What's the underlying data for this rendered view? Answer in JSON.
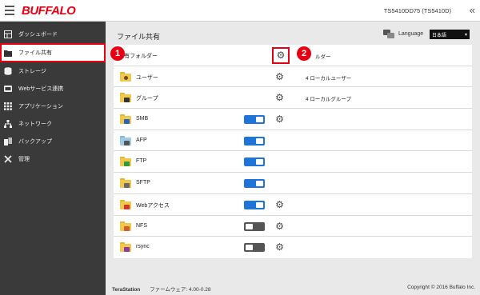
{
  "topbar": {
    "logo": "BUFFALO",
    "device": "TS5410DD75 (TS5410D)",
    "collapse_icon": "double-chevron-left-icon"
  },
  "sidebar": {
    "items": [
      {
        "label": "ダッシュボード",
        "icon": "dashboard-icon"
      },
      {
        "label": "ファイル共有",
        "icon": "folder-icon",
        "active": true
      },
      {
        "label": "ストレージ",
        "icon": "storage-icon"
      },
      {
        "label": "Webサービス連携",
        "icon": "web-service-icon"
      },
      {
        "label": "アプリケーション",
        "icon": "apps-grid-icon"
      },
      {
        "label": "ネットワーク",
        "icon": "network-icon"
      },
      {
        "label": "バックアップ",
        "icon": "backup-icon"
      },
      {
        "label": "管理",
        "icon": "tools-icon"
      }
    ]
  },
  "main": {
    "title": "ファイル共有",
    "language_label": "Language",
    "language_value": "日本語"
  },
  "rows": [
    {
      "name": "共有フォルダー",
      "header": true,
      "gear": true,
      "info": "ルダー"
    },
    {
      "name": "ユーザー",
      "gear": true,
      "info": "4 ローカルユーザー",
      "badge_color": "#6b4a2b"
    },
    {
      "name": "グループ",
      "gear": true,
      "info": "4 ローカルグループ",
      "badge_color": "#333333"
    },
    {
      "name": "SMB",
      "toggle": "on",
      "gear": true,
      "badge_color": "#2c63b8"
    },
    {
      "name": "AFP",
      "toggle": "on",
      "badge_color": "#555555"
    },
    {
      "name": "FTP",
      "toggle": "on",
      "badge_color": "#2e9a3a"
    },
    {
      "name": "SFTP",
      "toggle": "on",
      "badge_color": "#6a6a6a"
    },
    {
      "name": "Webアクセス",
      "toggle": "on",
      "gear": true,
      "badge_color": "#d0342c"
    },
    {
      "name": "NFS",
      "toggle": "off",
      "gear": true,
      "badge_color": "#d35c2c"
    },
    {
      "name": "rsync",
      "toggle": "off",
      "gear": true,
      "badge_color": "#8a3aa0"
    }
  ],
  "callouts": [
    "1",
    "2"
  ],
  "footer": {
    "brand": "TeraStation",
    "firmware": "ファームウェア: 4.00-0.28",
    "copyright": "Copyright © 2016 Buffalo Inc."
  },
  "colors": {
    "accent_red": "#e60012",
    "toggle_on": "#1f74d8",
    "sidebar_bg": "#3a3a3a"
  }
}
